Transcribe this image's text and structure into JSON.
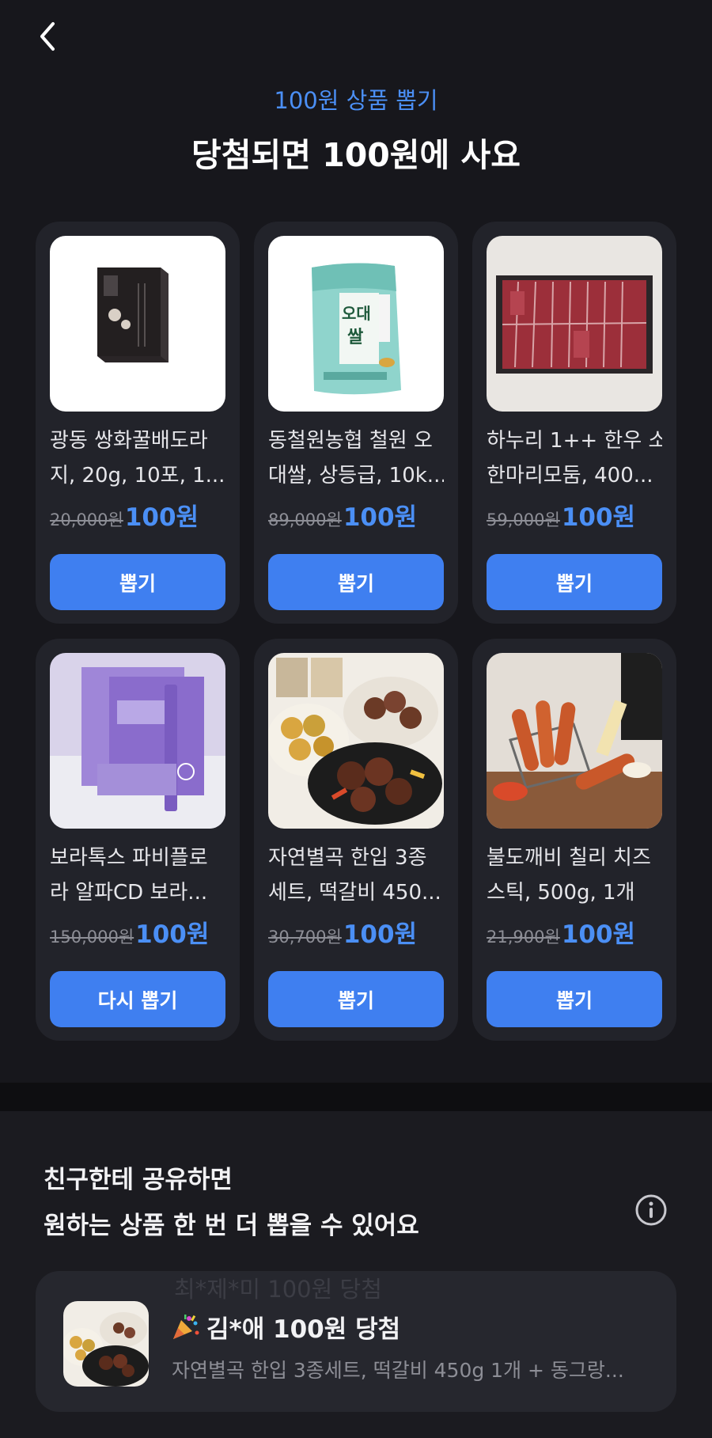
{
  "header": {
    "subtitle": "100원 상품 뽑기",
    "title": "당첨되면 100원에 사요"
  },
  "products": [
    {
      "name_line1": "광동 쌍화꿀배도라",
      "name_line2": "지, 20g, 10포, 1...",
      "original_price": "20,000원",
      "sale_price": "100원",
      "button": "뽑기",
      "image": "honey-drink-box"
    },
    {
      "name_line1": "동철원농협 철원 오",
      "name_line2": "대쌀, 상등급, 10k...",
      "original_price": "89,000원",
      "sale_price": "100원",
      "button": "뽑기",
      "image": "rice-bag"
    },
    {
      "name_line1": "하누리 1++ 한우 소",
      "name_line2": "한마리모둠, 400...",
      "original_price": "59,000원",
      "sale_price": "100원",
      "button": "뽑기",
      "image": "beef-tray"
    },
    {
      "name_line1": "보라톡스 파비플로",
      "name_line2": "라 알파CD 보라...",
      "original_price": "150,000원",
      "sale_price": "100원",
      "button": "다시 뽑기",
      "image": "purple-supplement-box"
    },
    {
      "name_line1": "자연별곡 한입 3종",
      "name_line2": "세트, 떡갈비 450...",
      "original_price": "30,700원",
      "sale_price": "100원",
      "button": "뽑기",
      "image": "tteokgalbi-plate"
    },
    {
      "name_line1": "불도깨비 칠리 치즈",
      "name_line2": "스틱, 500g, 1개",
      "original_price": "21,900원",
      "sale_price": "100원",
      "button": "뽑기",
      "image": "cheese-sticks"
    }
  ],
  "share": {
    "line1": "친구한테 공유하면",
    "line2": "원하는 상품 한 번 더 뽑을 수 있어요",
    "info_icon": "info-circle-icon"
  },
  "ticker": {
    "ghost_text": "최*제*미 100원 당첨",
    "winner": "김*애 100원 당첨",
    "product": "자연별곡 한입 3종세트, 떡갈비 450g 1개 + 동그랑...",
    "icon": "party-popper-icon"
  },
  "colors": {
    "background": "#17171c",
    "card": "#22232a",
    "accent": "#4b8ff5",
    "button": "#3f7ff0"
  }
}
